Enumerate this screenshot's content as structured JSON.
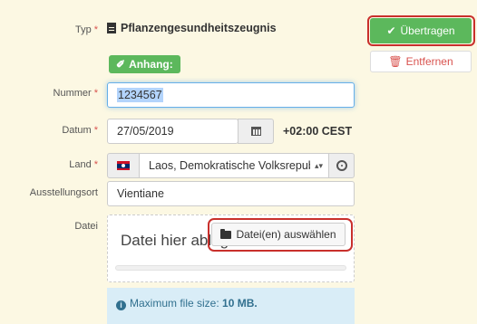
{
  "form": {
    "typ_label": "Typ",
    "typ_value": "Pflanzengesundheitszeugnis",
    "attachment_badge": "Anhang:",
    "nummer_label": "Nummer",
    "nummer_value": "1234567",
    "datum_label": "Datum",
    "datum_value": "27/05/2019",
    "timezone": "+02:00 CEST",
    "land_label": "Land",
    "land_value": "Laos, Demokratische Volksrepublik",
    "ausstellungsort_label": "Ausstellungsort",
    "ausstellungsort_value": "Vientiane",
    "datei_label": "Datei",
    "drop_text": "Datei hier ablegen",
    "choose_button": "Datei(en) auswählen",
    "max_size_prefix": "Maximum file size:",
    "max_size_value": "10 MB."
  },
  "actions": {
    "transfer": "Übertragen",
    "remove": "Entfernen"
  },
  "colors": {
    "background": "#fcf8e3",
    "success": "#5cb85c",
    "danger": "#d9534f",
    "info_bg": "#d9edf7"
  }
}
